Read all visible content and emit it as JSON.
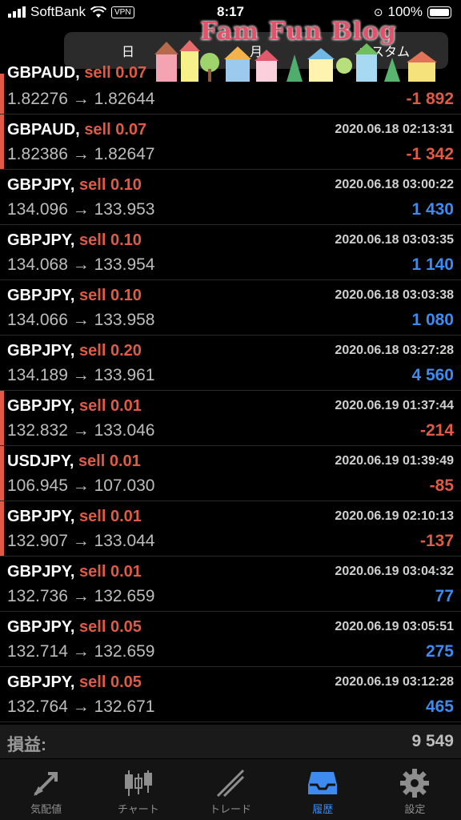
{
  "status_bar": {
    "carrier": "SoftBank",
    "vpn": "VPN",
    "time": "8:17",
    "battery": "100%"
  },
  "header": {
    "segments": [
      "日",
      "月",
      "カスタム"
    ],
    "banner_title": "Fam Fun Blog"
  },
  "colors": {
    "loss": "#e05a45",
    "profit": "#3d8bf0",
    "accent": "#3d8bf0"
  },
  "trades": [
    {
      "symbol": "GBPAUD,",
      "side": "sell",
      "lots": "0.07",
      "time": "",
      "price": "1.82276 → 1.82644",
      "pl": "-1 892",
      "result": "loss"
    },
    {
      "symbol": "GBPAUD,",
      "side": "sell",
      "lots": "0.07",
      "time": "2020.06.18 02:13:31",
      "price": "1.82386 → 1.82647",
      "pl": "-1 342",
      "result": "loss"
    },
    {
      "symbol": "GBPJPY,",
      "side": "sell",
      "lots": "0.10",
      "time": "2020.06.18 03:00:22",
      "price": "134.096 → 133.953",
      "pl": "1 430",
      "result": "profit"
    },
    {
      "symbol": "GBPJPY,",
      "side": "sell",
      "lots": "0.10",
      "time": "2020.06.18 03:03:35",
      "price": "134.068 → 133.954",
      "pl": "1 140",
      "result": "profit"
    },
    {
      "symbol": "GBPJPY,",
      "side": "sell",
      "lots": "0.10",
      "time": "2020.06.18 03:03:38",
      "price": "134.066 → 133.958",
      "pl": "1 080",
      "result": "profit"
    },
    {
      "symbol": "GBPJPY,",
      "side": "sell",
      "lots": "0.20",
      "time": "2020.06.18 03:27:28",
      "price": "134.189 → 133.961",
      "pl": "4 560",
      "result": "profit"
    },
    {
      "symbol": "GBPJPY,",
      "side": "sell",
      "lots": "0.01",
      "time": "2020.06.19 01:37:44",
      "price": "132.832 → 133.046",
      "pl": "-214",
      "result": "loss"
    },
    {
      "symbol": "USDJPY,",
      "side": "sell",
      "lots": "0.01",
      "time": "2020.06.19 01:39:49",
      "price": "106.945 → 107.030",
      "pl": "-85",
      "result": "loss"
    },
    {
      "symbol": "GBPJPY,",
      "side": "sell",
      "lots": "0.01",
      "time": "2020.06.19 02:10:13",
      "price": "132.907 → 133.044",
      "pl": "-137",
      "result": "loss"
    },
    {
      "symbol": "GBPJPY,",
      "side": "sell",
      "lots": "0.01",
      "time": "2020.06.19 03:04:32",
      "price": "132.736 → 132.659",
      "pl": "77",
      "result": "profit"
    },
    {
      "symbol": "GBPJPY,",
      "side": "sell",
      "lots": "0.05",
      "time": "2020.06.19 03:05:51",
      "price": "132.714 → 132.659",
      "pl": "275",
      "result": "profit"
    },
    {
      "symbol": "GBPJPY,",
      "side": "sell",
      "lots": "0.05",
      "time": "2020.06.19 03:12:28",
      "price": "132.764 → 132.671",
      "pl": "465",
      "result": "profit"
    }
  ],
  "total": {
    "label": "損益:",
    "value": "9 549"
  },
  "tabbar": {
    "tabs": [
      {
        "label": "気配値",
        "icon": "quotes-arrows-icon"
      },
      {
        "label": "チャート",
        "icon": "candlestick-icon"
      },
      {
        "label": "トレード",
        "icon": "trend-line-icon"
      },
      {
        "label": "履歴",
        "icon": "inbox-tray-icon",
        "active": true
      },
      {
        "label": "設定",
        "icon": "gear-icon"
      }
    ]
  }
}
